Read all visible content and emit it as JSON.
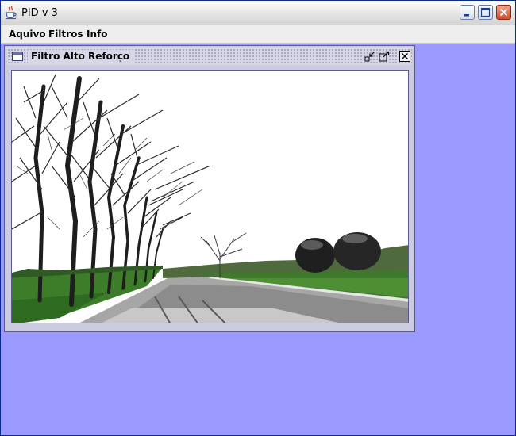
{
  "window": {
    "title": "PID v 3",
    "icon": "java-cup-icon",
    "controls": [
      "minimize-icon",
      "maximize-icon",
      "close-icon"
    ]
  },
  "menubar": {
    "items": [
      {
        "label": "Aquivo"
      },
      {
        "label": "Filtros"
      },
      {
        "label": "Info"
      }
    ]
  },
  "internal_frame": {
    "title": "Filtro Alto Reforço",
    "icon": "frame-icon",
    "controls": [
      "iconify-icon",
      "maximize-icon",
      "close-icon"
    ],
    "image_description": "filtered photo of a wet road lined with bare trees and a large sculpture on the right"
  },
  "colors": {
    "desktop": "#9999ff",
    "titlebar": "#e6e6e6",
    "menubar": "#eeeeee",
    "close_button": "#d2492b"
  }
}
